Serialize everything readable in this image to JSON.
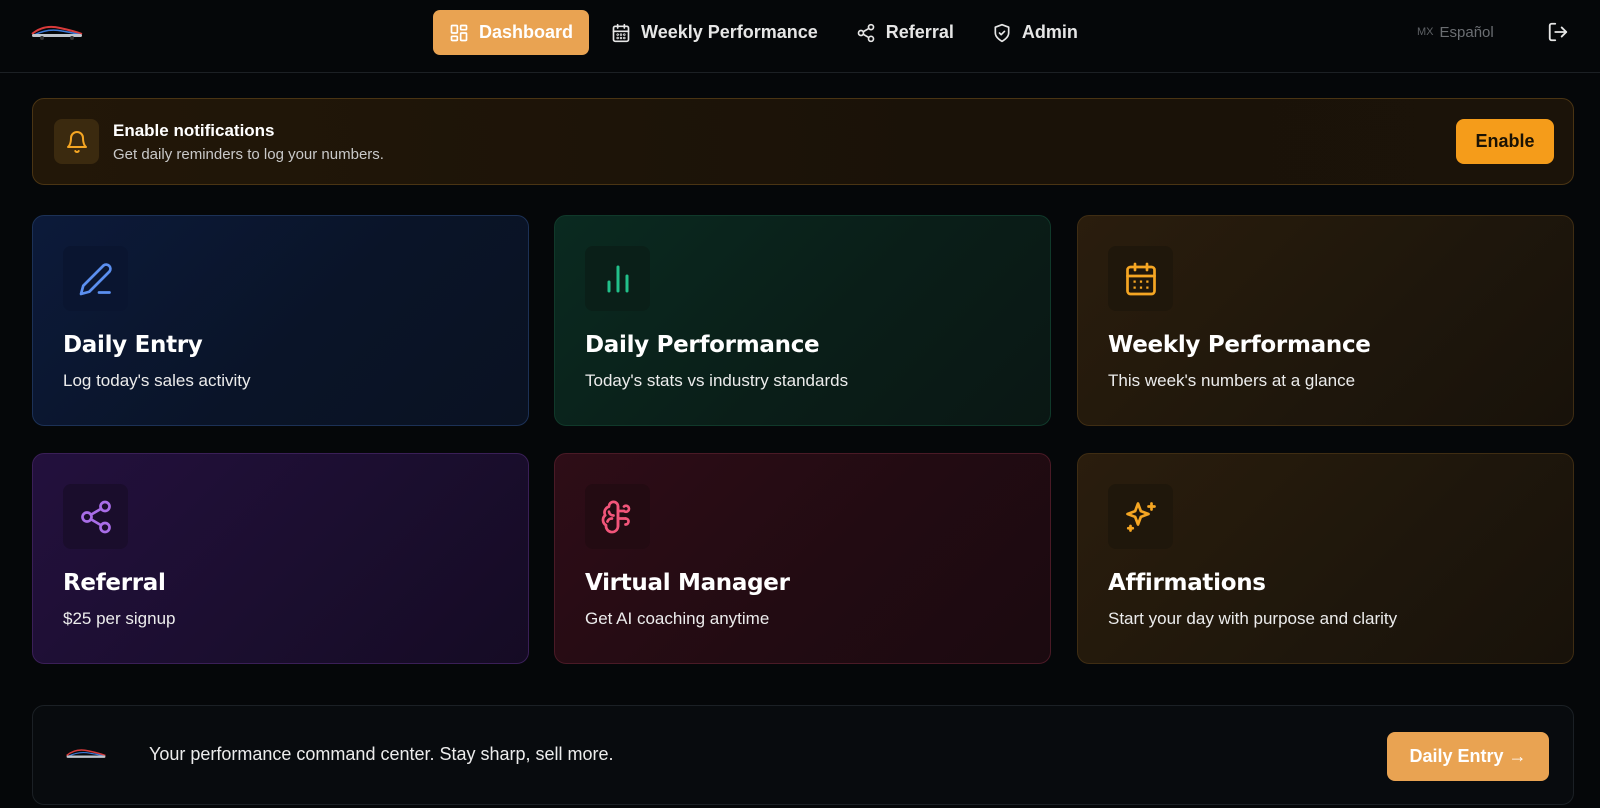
{
  "nav": {
    "items": [
      {
        "label": "Dashboard",
        "icon": "grid-icon",
        "active": true
      },
      {
        "label": "Weekly Performance",
        "icon": "calendar-icon",
        "active": false
      },
      {
        "label": "Referral",
        "icon": "share-icon",
        "active": false
      },
      {
        "label": "Admin",
        "icon": "shield-icon",
        "active": false
      }
    ],
    "language_flag": "MX",
    "language_label": "Español"
  },
  "notification": {
    "title": "Enable notifications",
    "subtitle": "Get daily reminders to log your numbers.",
    "button_label": "Enable"
  },
  "cards": [
    {
      "title": "Daily Entry",
      "subtitle": "Log today's sales activity",
      "icon": "pencil-icon",
      "accent": "#5b8ff0"
    },
    {
      "title": "Daily Performance",
      "subtitle": "Today's stats vs industry standards",
      "icon": "bar-chart-icon",
      "accent": "#22c08a"
    },
    {
      "title": "Weekly Performance",
      "subtitle": "This week's numbers at a glance",
      "icon": "calendar-icon",
      "accent": "#f5a623"
    },
    {
      "title": "Referral",
      "subtitle": "$25 per signup",
      "icon": "share-icon",
      "accent": "#a96de8"
    },
    {
      "title": "Virtual Manager",
      "subtitle": "Get AI coaching anytime",
      "icon": "brain-icon",
      "accent": "#f2557a"
    },
    {
      "title": "Affirmations",
      "subtitle": "Start your day with purpose and clarity",
      "icon": "sparkles-icon",
      "accent": "#f5a623"
    }
  ],
  "footer": {
    "tagline": "Your performance command center. Stay sharp, sell more.",
    "button_label": "Daily Entry →"
  },
  "colors": {
    "primary": "#e9a352",
    "enable": "#f59c1a",
    "background": "#050709"
  }
}
